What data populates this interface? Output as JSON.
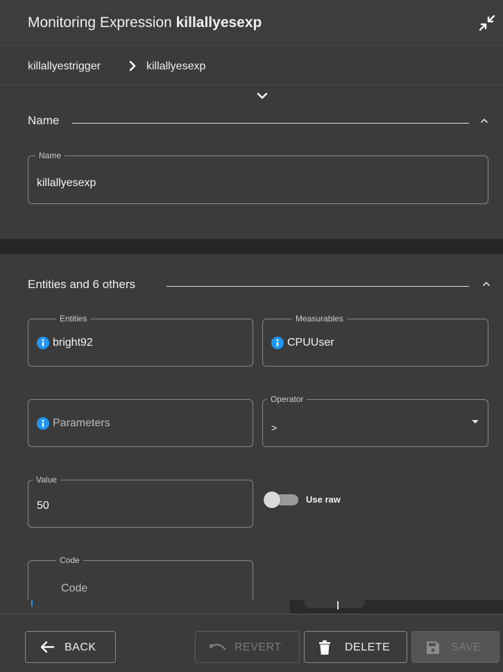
{
  "header": {
    "title_prefix": "Monitoring Expression",
    "title_name": "killallyesexp"
  },
  "breadcrumb": {
    "items": [
      "killallyestrigger",
      "killallyesexp"
    ]
  },
  "name_section": {
    "title": "Name",
    "name_field": {
      "legend": "Name",
      "value": "killallyesexp"
    }
  },
  "entities_section": {
    "title": "Entities and 6 others",
    "entities": {
      "legend": "Entities",
      "value": "bright92"
    },
    "measurables": {
      "legend": "Measurables",
      "value": "CPUUser"
    },
    "parameters": {
      "placeholder": "Parameters"
    },
    "operator": {
      "legend": "Operator",
      "value": ">"
    },
    "value_field": {
      "legend": "Value",
      "value": "50"
    },
    "use_raw": {
      "label": "Use raw",
      "on": false
    },
    "code": {
      "legend": "Code",
      "placeholder": "Code"
    }
  },
  "footer": {
    "back": "BACK",
    "revert": "REVERT",
    "delete": "DELETE",
    "save": "SAVE"
  },
  "colors": {
    "background": "#3b3b3b",
    "info_icon": "#2196f3",
    "divider_band": "#262626"
  },
  "icons": {
    "collapse": "collapse-arrows-icon",
    "breadcrumb_separator": "chevron-right-icon",
    "expand": "chevron-down-icon",
    "section_collapse": "chevron-up-icon",
    "info": "info-icon",
    "dropdown": "caret-down-icon",
    "back": "arrow-left-icon",
    "revert": "undo-icon",
    "delete": "trash-icon",
    "save": "floppy-disk-icon"
  }
}
